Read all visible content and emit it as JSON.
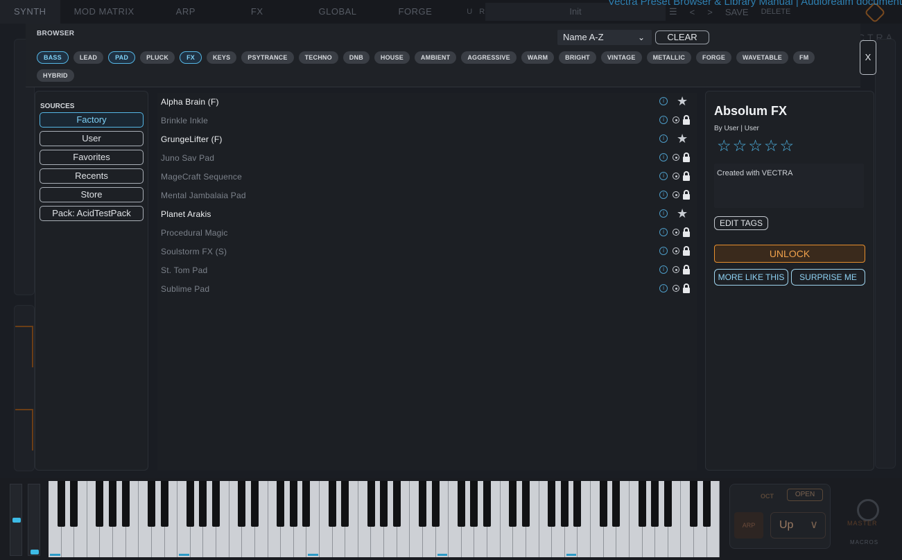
{
  "topnav": {
    "tabs": [
      "SYNTH",
      "MOD MATRIX",
      "ARP",
      "FX",
      "GLOBAL",
      "FORGE"
    ],
    "undo": "U",
    "redo": "R",
    "preset_name": "Init",
    "menu_icon": "hamburger-icon",
    "prev": "<",
    "next": ">",
    "save": "SAVE",
    "delete": "DELETE"
  },
  "watermark": "Vectra Preset Browser & Library Manual | Audiorealm document",
  "vectra_brand": "CTRA",
  "browser": {
    "label": "BROWSER",
    "sort_value": "Name A-Z",
    "sort_chevron": "⌄",
    "clear_label": "CLEAR",
    "close_label": "X",
    "tags": [
      {
        "label": "BASS",
        "selected": true
      },
      {
        "label": "LEAD",
        "selected": false
      },
      {
        "label": "PAD",
        "selected": true
      },
      {
        "label": "PLUCK",
        "selected": false
      },
      {
        "label": "FX",
        "selected": true
      },
      {
        "label": "KEYS",
        "selected": false
      },
      {
        "label": "PSYTRANCE",
        "selected": false
      },
      {
        "label": "TECHNO",
        "selected": false
      },
      {
        "label": "DNB",
        "selected": false
      },
      {
        "label": "HOUSE",
        "selected": false
      },
      {
        "label": "AMBIENT",
        "selected": false
      },
      {
        "label": "AGGRESSIVE",
        "selected": false
      },
      {
        "label": "WARM",
        "selected": false
      },
      {
        "label": "BRIGHT",
        "selected": false
      },
      {
        "label": "VINTAGE",
        "selected": false
      },
      {
        "label": "METALLIC",
        "selected": false
      },
      {
        "label": "FORGE",
        "selected": false
      },
      {
        "label": "WAVETABLE",
        "selected": false
      },
      {
        "label": "FM",
        "selected": false
      },
      {
        "label": "HYBRID",
        "selected": false
      }
    ]
  },
  "sources": {
    "title": "SOURCES",
    "items": [
      {
        "label": "Factory",
        "selected": true
      },
      {
        "label": "User",
        "selected": false
      },
      {
        "label": "Favorites",
        "selected": false
      },
      {
        "label": "Recents",
        "selected": false
      },
      {
        "label": "Store",
        "selected": false
      },
      {
        "label": "Pack: AcidTestPack",
        "selected": false
      }
    ]
  },
  "presets": [
    {
      "name": "Alpha Brain (F)",
      "owned": true
    },
    {
      "name": "Brinkle Inkle",
      "owned": false
    },
    {
      "name": "GrungeLifter (F)",
      "owned": true
    },
    {
      "name": "Juno Sav Pad",
      "owned": false
    },
    {
      "name": "MageCraft Sequence",
      "owned": false
    },
    {
      "name": "Mental Jambalaia Pad",
      "owned": false
    },
    {
      "name": "Planet Arakis",
      "owned": true
    },
    {
      "name": "Procedural Magic",
      "owned": false
    },
    {
      "name": "Soulstorm FX (S)",
      "owned": false
    },
    {
      "name": "St. Tom Pad",
      "owned": false
    },
    {
      "name": "Sublime Pad",
      "owned": false
    }
  ],
  "detail": {
    "title": "Absolum FX",
    "author": "By User  |  User",
    "rating": 0,
    "rating_max": 5,
    "description": "Created with VECTRA",
    "edit_tags_label": "EDIT TAGS",
    "unlock_label": "UNLOCK",
    "more_like_this_label": "MORE LIKE THIS",
    "surprise_me_label": "SURPRISE ME"
  },
  "footer": {
    "oct_label": "OCT",
    "open_label": "OPEN",
    "arp_label": "ARP",
    "arp_mode": "Up",
    "master_label": "MASTER",
    "macros_label": "MACROS"
  },
  "colors": {
    "accent_blue": "#55b7e6",
    "unlock_orange": "#e8902f",
    "panel_bg": "#1d2025"
  }
}
